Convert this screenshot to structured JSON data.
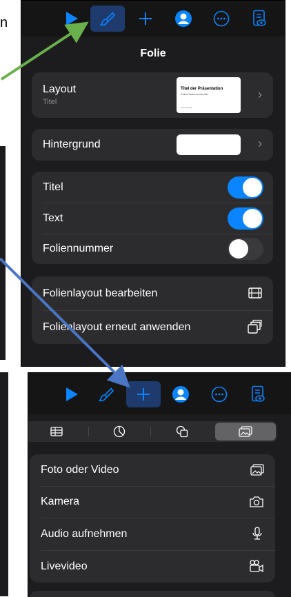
{
  "colors": {
    "accent": "#0a84ff",
    "panel": "#1c1c1e",
    "group": "#2c2c2e",
    "arrow_green": "#6ab04c",
    "arrow_blue": "#4a76c4"
  },
  "background_text": "n",
  "top_panel": {
    "title": "Folie",
    "layout": {
      "label": "Layout",
      "sub": "Titel",
      "thumb_title": "Titel der Präsentation",
      "thumb_subtitle": "Präsentationsuntertitel",
      "thumb_footer": "sehr wertvoll"
    },
    "background": {
      "label": "Hintergrund"
    },
    "toggles": [
      {
        "label": "Titel",
        "on": true
      },
      {
        "label": "Text",
        "on": true
      },
      {
        "label": "Foliennummer",
        "on": false
      }
    ],
    "actions": [
      {
        "label": "Folienlayout bearbeiten",
        "icon": "edit-layout-icon"
      },
      {
        "label": "Folienlayout erneut anwenden",
        "icon": "reapply-layout-icon"
      }
    ]
  },
  "bottom_panel": {
    "segments": [
      "table-icon",
      "chart-icon",
      "shapes-icon",
      "media-icon"
    ],
    "selected_segment": 3,
    "items": [
      {
        "label": "Foto oder Video",
        "icon": "photo-icon"
      },
      {
        "label": "Kamera",
        "icon": "camera-icon"
      },
      {
        "label": "Audio aufnehmen",
        "icon": "microphone-icon"
      },
      {
        "label": "Livevideo",
        "icon": "live-video-icon"
      }
    ]
  }
}
